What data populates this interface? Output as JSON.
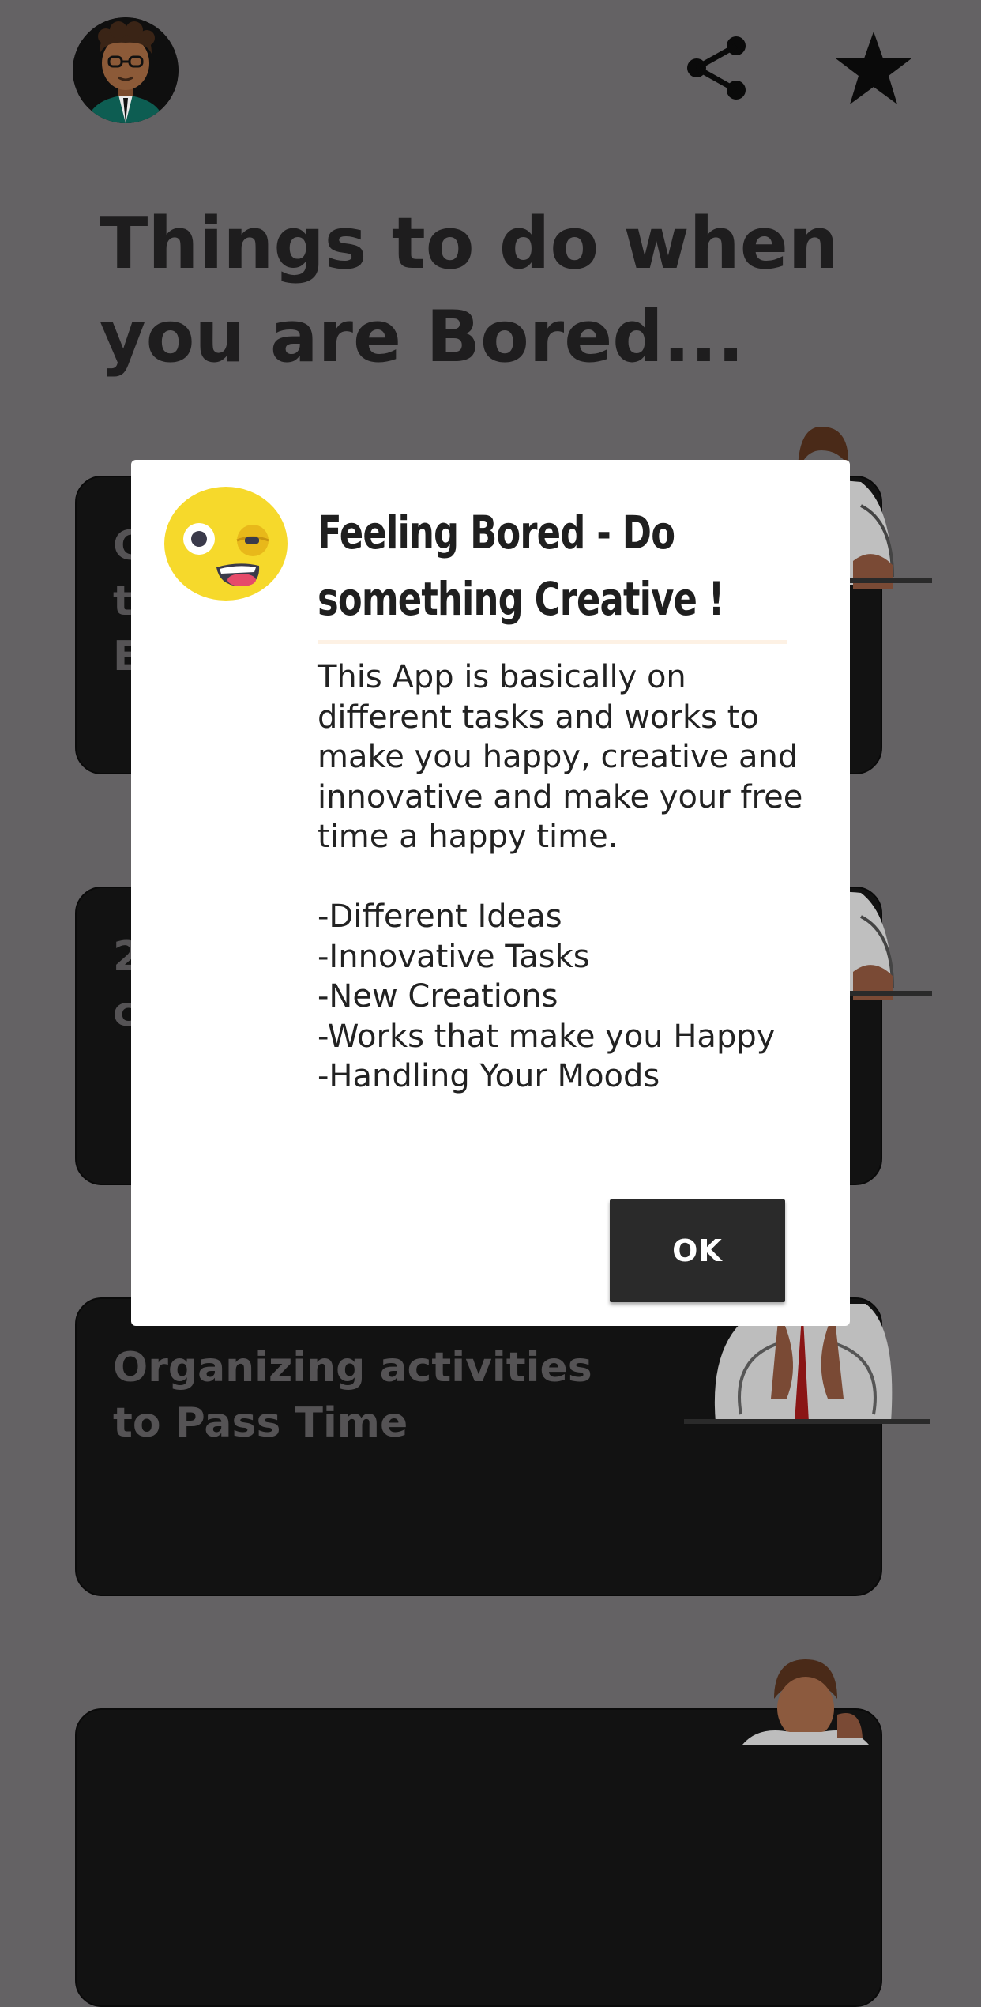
{
  "header": {
    "avatar_icon": "user-avatar-icon",
    "share_icon": "share-icon",
    "star_icon": "star-icon"
  },
  "main": {
    "title": "Things to do when you are Bored...",
    "cards": [
      {
        "title_fragment": "C\nt\nE"
      },
      {
        "title_fragment": "2\nc"
      },
      {
        "title": "Organizing activities to Pass Time"
      }
    ]
  },
  "dialog": {
    "icon": "bored-emoji-icon",
    "title": "Feeling Bored - Do something Creative !",
    "message": "This App is basically on different tasks and works to make you happy, creative and innovative and make your free time a happy time.\n\n-Different Ideas\n-Innovative Tasks\n-New Creations\n-Works that make you Happy\n-Handling Your Moods",
    "ok_label": "OK"
  },
  "colors": {
    "background": "#646264",
    "card": "#121212",
    "button": "#2a2a2a",
    "emoji": "#f6d92b"
  }
}
